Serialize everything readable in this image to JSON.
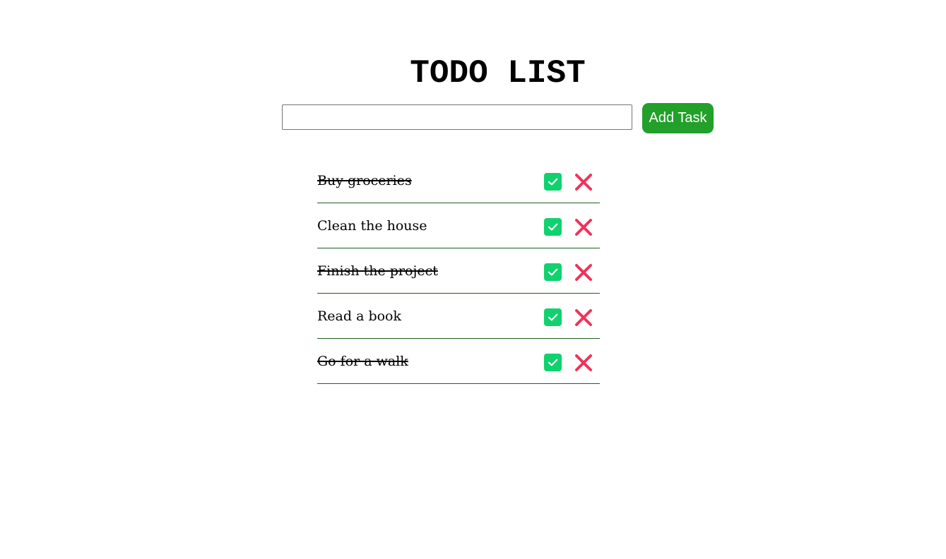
{
  "header": {
    "title": "TODO LIST"
  },
  "add_form": {
    "input_value": "",
    "input_placeholder": "",
    "add_button_label": "Add Task",
    "add_button_color": "#22a02a"
  },
  "tasks": [
    {
      "text": "Buy groceries",
      "completed": true
    },
    {
      "text": "Clean the house",
      "completed": false
    },
    {
      "text": "Finish the project",
      "completed": true
    },
    {
      "text": "Read a book",
      "completed": false
    },
    {
      "text": "Go for a walk",
      "completed": true
    }
  ],
  "icons": {
    "complete": "checkbox-check-icon",
    "delete": "close-x-icon"
  },
  "colors": {
    "check": "#0fd26e",
    "delete": "#f0325a",
    "divider": "#1f5f1f"
  }
}
